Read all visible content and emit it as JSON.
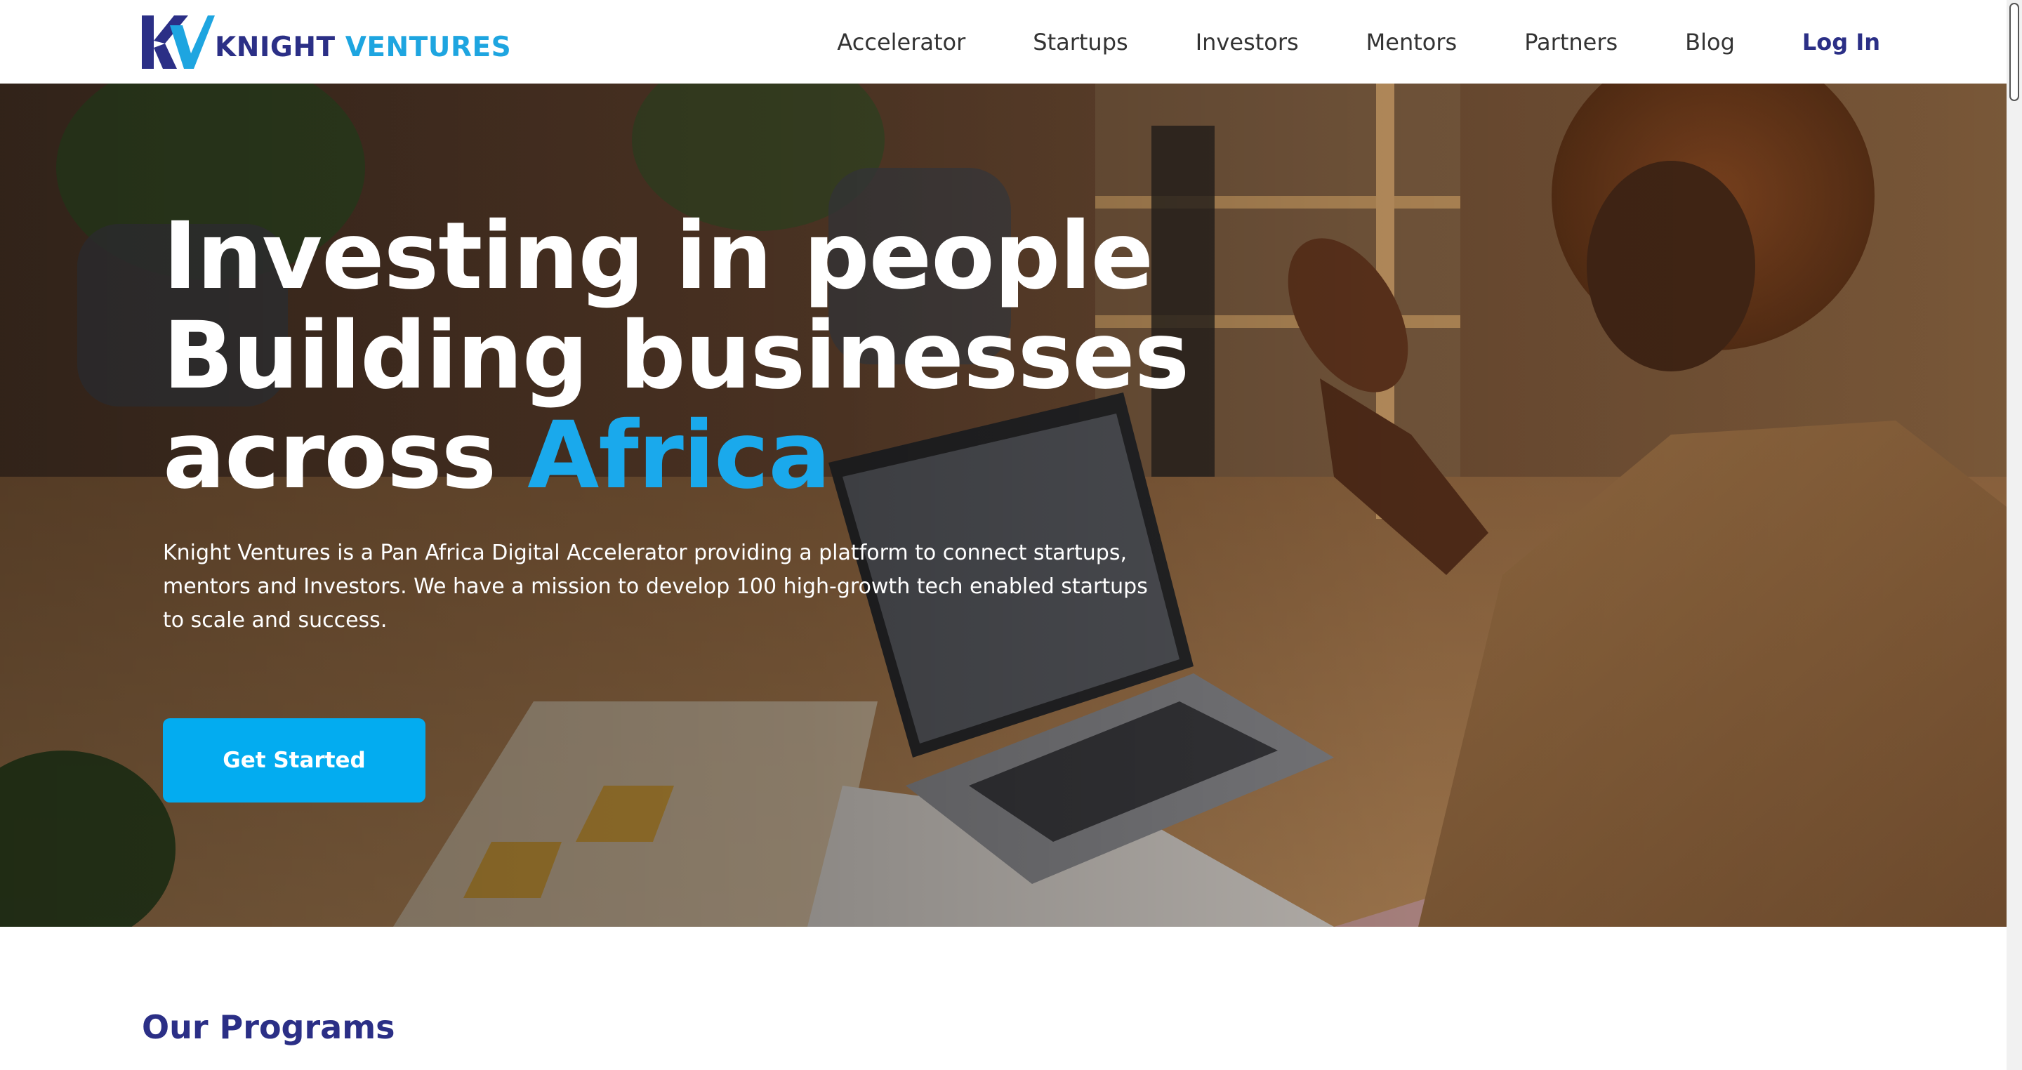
{
  "brand": {
    "name_part1": "KNIGHT",
    "name_part2": "VENTURES",
    "color_primary": "#2b2f86",
    "color_accent": "#1ea5e0"
  },
  "nav": {
    "items": [
      {
        "label": "Accelerator"
      },
      {
        "label": "Startups"
      },
      {
        "label": "Investors"
      },
      {
        "label": "Mentors"
      },
      {
        "label": "Partners"
      },
      {
        "label": "Blog"
      }
    ],
    "login_label": "Log In"
  },
  "hero": {
    "title_line1": "Investing in people",
    "title_line2": "Building businesses",
    "title_line3_prefix": "across ",
    "title_line3_accent": "Africa",
    "description": "Knight Ventures is a Pan Africa Digital Accelerator providing a platform to connect startups, mentors and Investors. We have a mission to develop 100 high-growth tech enabled startups to scale and success.",
    "cta_label": "Get Started",
    "accent_color": "#1aa9ec",
    "cta_color": "#03acf0"
  },
  "sections": {
    "programs_title": "Our Programs"
  }
}
